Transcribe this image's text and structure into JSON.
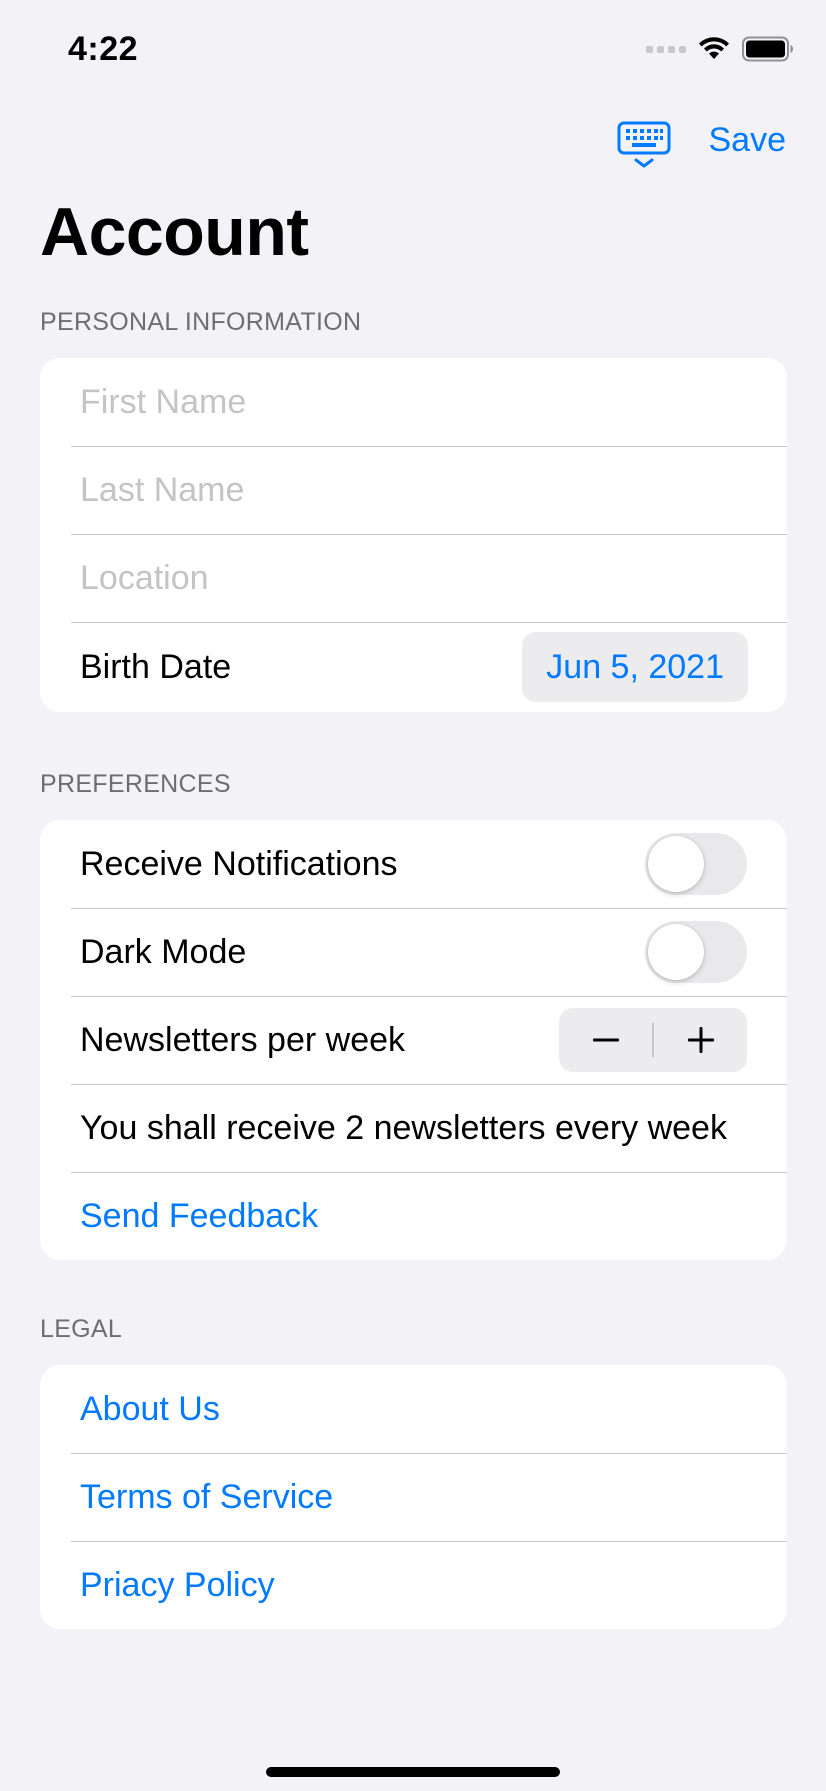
{
  "status_bar": {
    "time": "4:22",
    "signal_icon": "cellular-signal-icon",
    "wifi_icon": "wifi-icon",
    "battery_icon": "battery-icon"
  },
  "nav": {
    "keyboard_icon": "keyboard-dismiss-icon",
    "save_label": "Save"
  },
  "title": "Account",
  "sections": {
    "personal": {
      "header": "PERSONAL INFORMATION",
      "first_name_placeholder": "First Name",
      "last_name_placeholder": "Last Name",
      "location_placeholder": "Location",
      "birth_date_label": "Birth Date",
      "birth_date_value": "Jun 5, 2021"
    },
    "preferences": {
      "header": "PREFERENCES",
      "notifications_label": "Receive Notifications",
      "notifications_on": false,
      "dark_mode_label": "Dark Mode",
      "dark_mode_on": false,
      "newsletters_label": "Newsletters per week",
      "newsletters_summary": "You shall receive 2 newsletters every week",
      "feedback_label": "Send Feedback"
    },
    "legal": {
      "header": "LEGAL",
      "about_label": "About Us",
      "terms_label": "Terms of Service",
      "privacy_label": "Priacy Policy"
    }
  },
  "colors": {
    "accent": "#007aff",
    "background": "#f2f2f7",
    "card": "#ffffff",
    "secondary_text": "#6d6d72",
    "placeholder": "#c4c4c6"
  }
}
